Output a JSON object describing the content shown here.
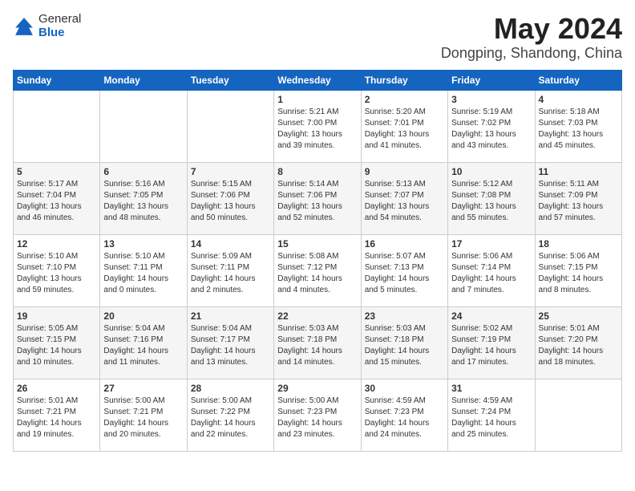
{
  "header": {
    "logo_general": "General",
    "logo_blue": "Blue",
    "title": "May 2024",
    "subtitle": "Dongping, Shandong, China"
  },
  "days_of_week": [
    "Sunday",
    "Monday",
    "Tuesday",
    "Wednesday",
    "Thursday",
    "Friday",
    "Saturday"
  ],
  "weeks": [
    [
      {
        "num": "",
        "detail": ""
      },
      {
        "num": "",
        "detail": ""
      },
      {
        "num": "",
        "detail": ""
      },
      {
        "num": "1",
        "detail": "Sunrise: 5:21 AM\nSunset: 7:00 PM\nDaylight: 13 hours\nand 39 minutes."
      },
      {
        "num": "2",
        "detail": "Sunrise: 5:20 AM\nSunset: 7:01 PM\nDaylight: 13 hours\nand 41 minutes."
      },
      {
        "num": "3",
        "detail": "Sunrise: 5:19 AM\nSunset: 7:02 PM\nDaylight: 13 hours\nand 43 minutes."
      },
      {
        "num": "4",
        "detail": "Sunrise: 5:18 AM\nSunset: 7:03 PM\nDaylight: 13 hours\nand 45 minutes."
      }
    ],
    [
      {
        "num": "5",
        "detail": "Sunrise: 5:17 AM\nSunset: 7:04 PM\nDaylight: 13 hours\nand 46 minutes."
      },
      {
        "num": "6",
        "detail": "Sunrise: 5:16 AM\nSunset: 7:05 PM\nDaylight: 13 hours\nand 48 minutes."
      },
      {
        "num": "7",
        "detail": "Sunrise: 5:15 AM\nSunset: 7:06 PM\nDaylight: 13 hours\nand 50 minutes."
      },
      {
        "num": "8",
        "detail": "Sunrise: 5:14 AM\nSunset: 7:06 PM\nDaylight: 13 hours\nand 52 minutes."
      },
      {
        "num": "9",
        "detail": "Sunrise: 5:13 AM\nSunset: 7:07 PM\nDaylight: 13 hours\nand 54 minutes."
      },
      {
        "num": "10",
        "detail": "Sunrise: 5:12 AM\nSunset: 7:08 PM\nDaylight: 13 hours\nand 55 minutes."
      },
      {
        "num": "11",
        "detail": "Sunrise: 5:11 AM\nSunset: 7:09 PM\nDaylight: 13 hours\nand 57 minutes."
      }
    ],
    [
      {
        "num": "12",
        "detail": "Sunrise: 5:10 AM\nSunset: 7:10 PM\nDaylight: 13 hours\nand 59 minutes."
      },
      {
        "num": "13",
        "detail": "Sunrise: 5:10 AM\nSunset: 7:11 PM\nDaylight: 14 hours\nand 0 minutes."
      },
      {
        "num": "14",
        "detail": "Sunrise: 5:09 AM\nSunset: 7:11 PM\nDaylight: 14 hours\nand 2 minutes."
      },
      {
        "num": "15",
        "detail": "Sunrise: 5:08 AM\nSunset: 7:12 PM\nDaylight: 14 hours\nand 4 minutes."
      },
      {
        "num": "16",
        "detail": "Sunrise: 5:07 AM\nSunset: 7:13 PM\nDaylight: 14 hours\nand 5 minutes."
      },
      {
        "num": "17",
        "detail": "Sunrise: 5:06 AM\nSunset: 7:14 PM\nDaylight: 14 hours\nand 7 minutes."
      },
      {
        "num": "18",
        "detail": "Sunrise: 5:06 AM\nSunset: 7:15 PM\nDaylight: 14 hours\nand 8 minutes."
      }
    ],
    [
      {
        "num": "19",
        "detail": "Sunrise: 5:05 AM\nSunset: 7:15 PM\nDaylight: 14 hours\nand 10 minutes."
      },
      {
        "num": "20",
        "detail": "Sunrise: 5:04 AM\nSunset: 7:16 PM\nDaylight: 14 hours\nand 11 minutes."
      },
      {
        "num": "21",
        "detail": "Sunrise: 5:04 AM\nSunset: 7:17 PM\nDaylight: 14 hours\nand 13 minutes."
      },
      {
        "num": "22",
        "detail": "Sunrise: 5:03 AM\nSunset: 7:18 PM\nDaylight: 14 hours\nand 14 minutes."
      },
      {
        "num": "23",
        "detail": "Sunrise: 5:03 AM\nSunset: 7:18 PM\nDaylight: 14 hours\nand 15 minutes."
      },
      {
        "num": "24",
        "detail": "Sunrise: 5:02 AM\nSunset: 7:19 PM\nDaylight: 14 hours\nand 17 minutes."
      },
      {
        "num": "25",
        "detail": "Sunrise: 5:01 AM\nSunset: 7:20 PM\nDaylight: 14 hours\nand 18 minutes."
      }
    ],
    [
      {
        "num": "26",
        "detail": "Sunrise: 5:01 AM\nSunset: 7:21 PM\nDaylight: 14 hours\nand 19 minutes."
      },
      {
        "num": "27",
        "detail": "Sunrise: 5:00 AM\nSunset: 7:21 PM\nDaylight: 14 hours\nand 20 minutes."
      },
      {
        "num": "28",
        "detail": "Sunrise: 5:00 AM\nSunset: 7:22 PM\nDaylight: 14 hours\nand 22 minutes."
      },
      {
        "num": "29",
        "detail": "Sunrise: 5:00 AM\nSunset: 7:23 PM\nDaylight: 14 hours\nand 23 minutes."
      },
      {
        "num": "30",
        "detail": "Sunrise: 4:59 AM\nSunset: 7:23 PM\nDaylight: 14 hours\nand 24 minutes."
      },
      {
        "num": "31",
        "detail": "Sunrise: 4:59 AM\nSunset: 7:24 PM\nDaylight: 14 hours\nand 25 minutes."
      },
      {
        "num": "",
        "detail": ""
      }
    ]
  ]
}
